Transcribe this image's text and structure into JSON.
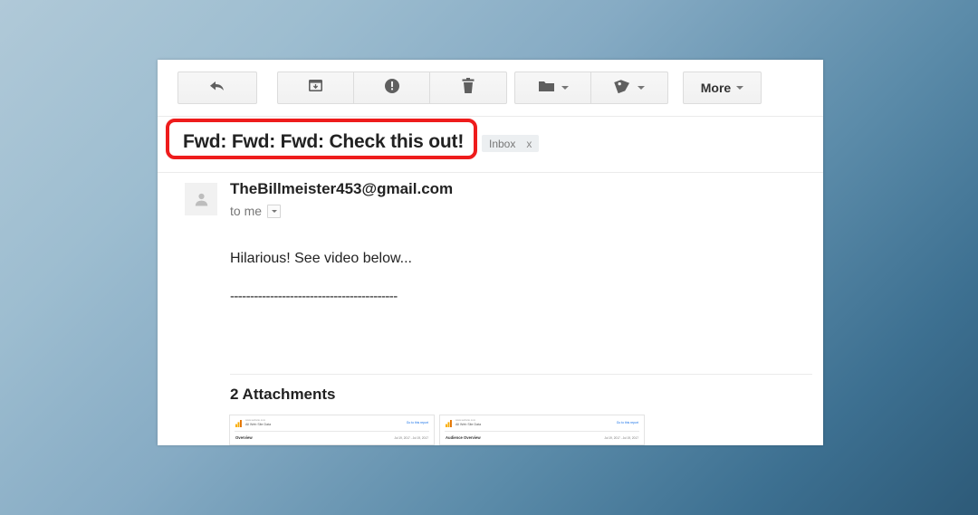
{
  "toolbar": {
    "reply": {
      "label": "Reply",
      "icon": "reply-arrow-icon"
    },
    "archive": {
      "label": "Archive",
      "icon": "archive-box-icon"
    },
    "spam": {
      "label": "Report spam",
      "icon": "exclamation-circle-icon"
    },
    "delete": {
      "label": "Delete",
      "icon": "trash-can-icon"
    },
    "move_to": {
      "label": "Move to",
      "icon": "folder-icon"
    },
    "labels": {
      "label": "Labels",
      "icon": "tag-icon"
    },
    "more": {
      "label": "More",
      "icon": "chevron-down-icon"
    }
  },
  "email": {
    "subject": "Fwd: Fwd: Fwd: Check this out!",
    "label_chip": "Inbox",
    "label_chip_remove": "x",
    "sender": "TheBillmeister453@gmail.com",
    "recipient": "to me",
    "body_line": "Hilarious! See video below...",
    "body_divider": "------------------------------------------"
  },
  "attachments": {
    "heading": "2 Attachments",
    "items": [
      {
        "account": "www.website.com",
        "property": "All Web Site Data",
        "link": "Go to this report",
        "title": "Overview",
        "dates": "Jul 19, 2017 - Jul 19, 2017"
      },
      {
        "account": "www.website.com",
        "property": "All Web Site Data",
        "link": "Go to this report",
        "title": "Audience Overview",
        "dates": "Jul 19, 2017 - Jul 19, 2017"
      }
    ]
  },
  "annotation": {
    "target": "subject-line",
    "color": "#ee1c1c"
  }
}
